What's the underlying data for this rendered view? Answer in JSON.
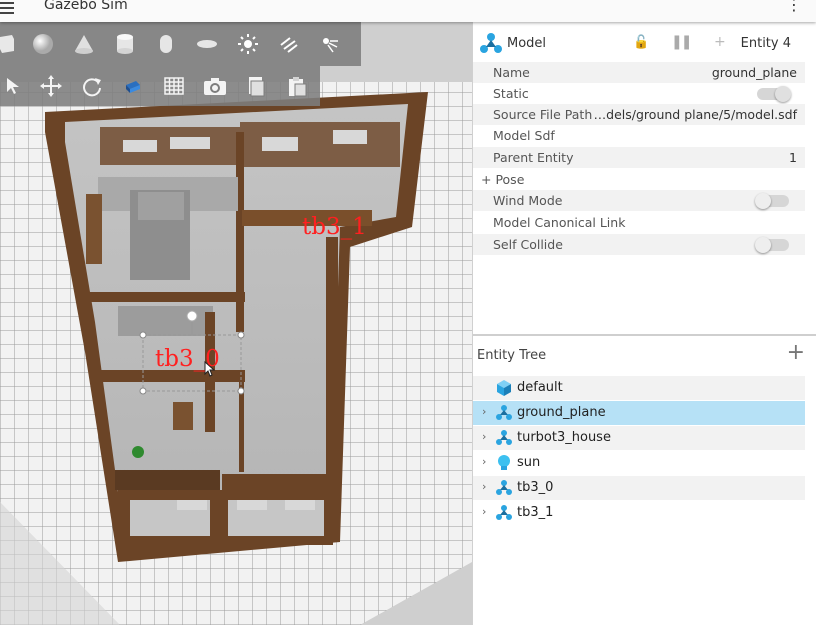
{
  "app": {
    "title": "Gazebo Sim"
  },
  "scene": {
    "labels": [
      "tb3_1",
      "tb3_0"
    ],
    "shape_tools": [
      "box-icon",
      "sphere-icon",
      "cone-icon",
      "cylinder-icon",
      "capsule-icon",
      "ellipsoid-icon",
      "point-light-icon",
      "directional-light-icon",
      "spot-light-icon"
    ],
    "transform_tools": [
      "select-icon",
      "translate-icon",
      "rotate-icon",
      "camera-view-icon",
      "grid-icon",
      "screenshot-icon",
      "copy-icon",
      "paste-icon"
    ]
  },
  "component_inspector": {
    "type_label": "Model",
    "entity_label": "Entity 4",
    "properties": [
      {
        "key": "Name",
        "value": "ground_plane"
      },
      {
        "key": "Static",
        "toggle": true
      },
      {
        "key": "Source File Path",
        "value": "…dels/ground plane/5/model.sdf"
      },
      {
        "key": "Model Sdf",
        "value": ""
      },
      {
        "key": "Parent Entity",
        "value": "1"
      },
      {
        "key": "+ Pose",
        "value": ""
      },
      {
        "key": "Wind Mode",
        "toggle": false
      },
      {
        "key": "Model Canonical Link",
        "value": ""
      },
      {
        "key": "Self Collide",
        "toggle": false
      }
    ]
  },
  "entity_tree": {
    "title": "Entity Tree",
    "items": [
      {
        "name": "default",
        "icon": "world-cube-icon",
        "expandable": false,
        "selected": false
      },
      {
        "name": "ground_plane",
        "icon": "model-icon",
        "expandable": true,
        "selected": true
      },
      {
        "name": "turbot3_house",
        "icon": "model-icon",
        "expandable": true,
        "selected": false
      },
      {
        "name": "sun",
        "icon": "light-bulb-icon",
        "expandable": true,
        "selected": false
      },
      {
        "name": "tb3_0",
        "icon": "model-icon",
        "expandable": true,
        "selected": false
      },
      {
        "name": "tb3_1",
        "icon": "model-icon",
        "expandable": true,
        "selected": false
      }
    ]
  },
  "colors": {
    "selection": "#b6e1f6",
    "accent": "#2aa4e0",
    "wood": "#6b4426",
    "label": "#ff2020"
  }
}
